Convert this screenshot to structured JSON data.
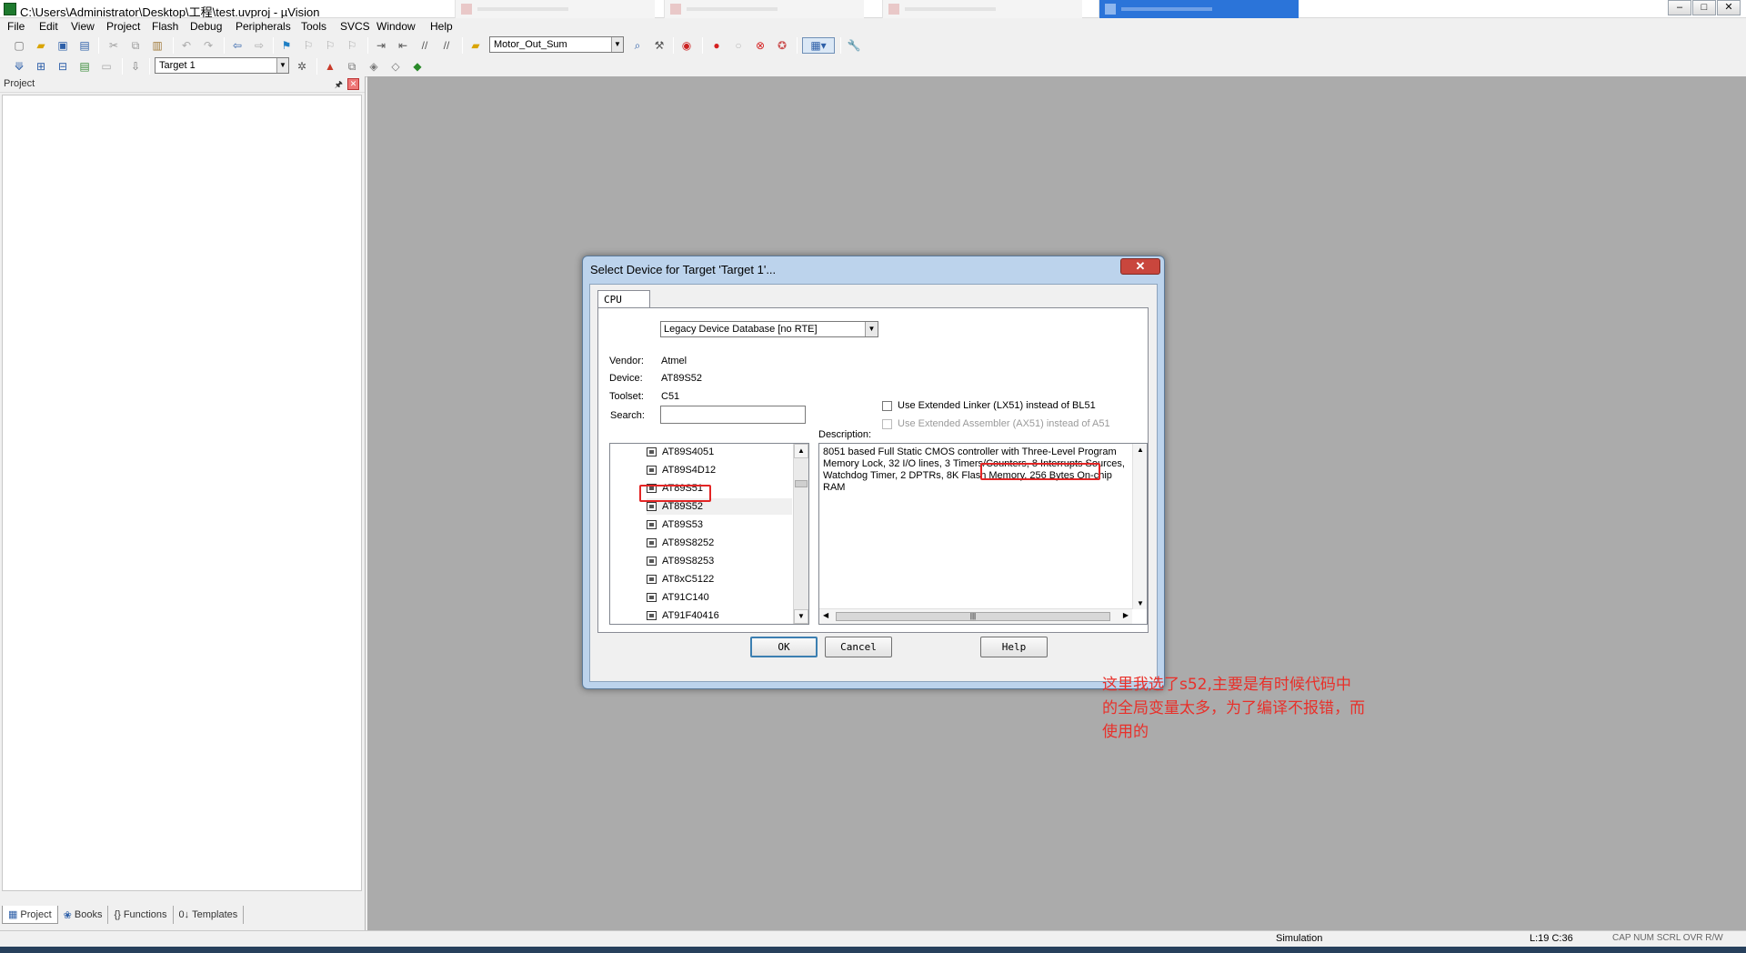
{
  "window": {
    "title": "C:\\Users\\Administrator\\Desktop\\工程\\test.uvproj - µVision",
    "controls": [
      "–",
      "□",
      "✕"
    ]
  },
  "menu": [
    "File",
    "Edit",
    "View",
    "Project",
    "Flash",
    "Debug",
    "Peripherals",
    "Tools",
    "SVCS",
    "Window",
    "Help"
  ],
  "toolbar": {
    "find_combo": "Motor_Out_Sum",
    "target_combo": "Target 1"
  },
  "project_panel": {
    "title": "Project",
    "pin": "🖈",
    "close": "✕",
    "tabs": [
      {
        "icon": "▦",
        "label": "Project"
      },
      {
        "icon": "❀",
        "label": "Books"
      },
      {
        "icon": "{}",
        "label": "Functions"
      },
      {
        "icon": "0↓",
        "label": "Templates"
      }
    ]
  },
  "dialog": {
    "title": "Select Device for Target 'Target 1'...",
    "close": "✕",
    "tab": "CPU",
    "database": "Legacy Device Database [no RTE]",
    "vendor_label": "Vendor:",
    "vendor": "Atmel",
    "device_label": "Device:",
    "device": "AT89S52",
    "toolset_label": "Toolset:",
    "toolset": "C51",
    "search_label": "Search:",
    "search_value": "",
    "option1": "Use Extended Linker (LX51) instead of BL51",
    "option2": "Use Extended Assembler (AX51) instead of A51",
    "description_label": "Description:",
    "description": "8051 based Full Static CMOS controller with Three-Level Program Memory Lock, 32 I/O lines, 3 Timers/Counters, 8 Interrupts Sources, Watchdog Timer, 2 DPTRs, 8K Flash Memory, 256 Bytes On-chip RAM",
    "devices": [
      "AT89S4051",
      "AT89S4D12",
      "AT89S51",
      "AT89S52",
      "AT89S53",
      "AT89S8252",
      "AT89S8253",
      "AT8xC5122",
      "AT91C140",
      "AT91F40416"
    ],
    "selected_device": "AT89S52",
    "annotation": "这里我选了s52,主要是有时候代码中的全局变量太多，为了编译不报错，而使用的",
    "buttons": {
      "ok": "OK",
      "cancel": "Cancel",
      "help": "Help"
    }
  },
  "status": {
    "mode": "Simulation",
    "position": "L:19 C:36",
    "keys": "CAP  NUM  SCRL  OVR  R/W"
  },
  "colors": {
    "annotation": "#e8302a",
    "mdi_background": "#ababab",
    "dialog_frame": "#bcd3ec"
  }
}
